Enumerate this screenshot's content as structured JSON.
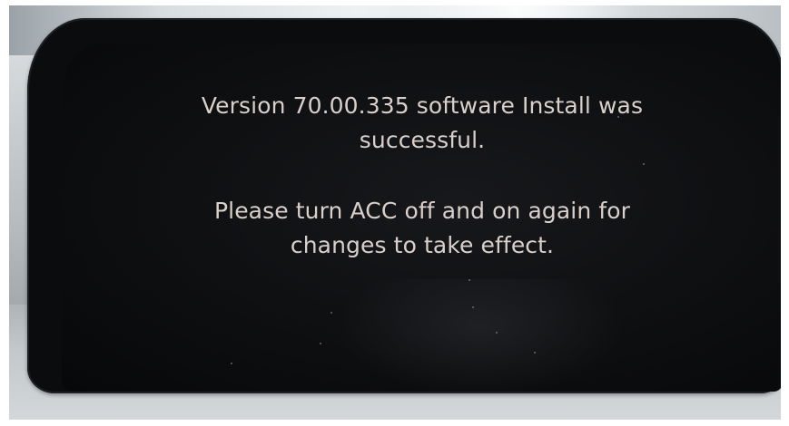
{
  "screen": {
    "message_line_1": "Version 70.00.335 software Install was",
    "message_line_2": "successful.",
    "message_line_3": "Please turn ACC off and on again for",
    "message_line_4": "changes to take effect."
  },
  "colors": {
    "screen_background": "#0e0f11",
    "text": "#d9cfcb",
    "bezel": "#0b0c0e"
  }
}
